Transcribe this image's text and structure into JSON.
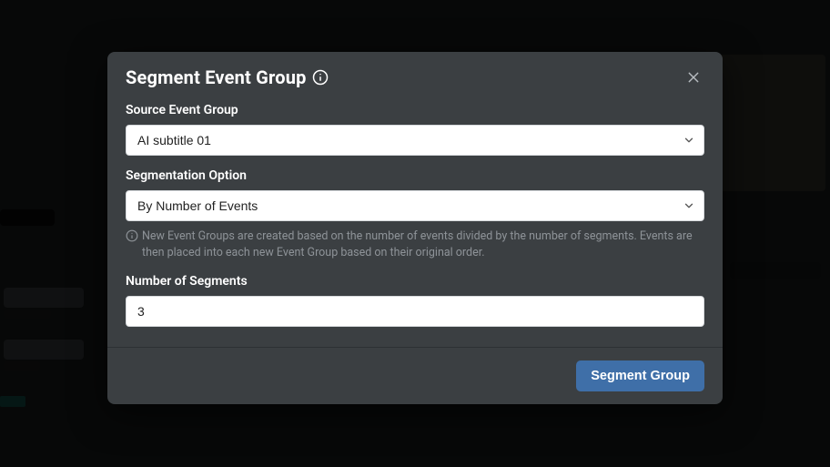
{
  "modal": {
    "title": "Segment Event Group",
    "source_group": {
      "label": "Source Event Group",
      "value": "AI subtitle 01"
    },
    "segmentation_option": {
      "label": "Segmentation Option",
      "value": "By Number of Events",
      "help": "New Event Groups are created based on the number of events divided by the number of segments. Events are then placed into each new Event Group based on their original order."
    },
    "num_segments": {
      "label": "Number of Segments",
      "value": "3"
    },
    "submit_label": "Segment Group"
  },
  "icons": {
    "info": "info-icon",
    "close": "close-icon",
    "chevron_down": "chevron-down-icon"
  },
  "colors": {
    "modal_bg": "#3b3f42",
    "primary_button": "#3f6fa8",
    "text_muted": "#8e9398"
  }
}
